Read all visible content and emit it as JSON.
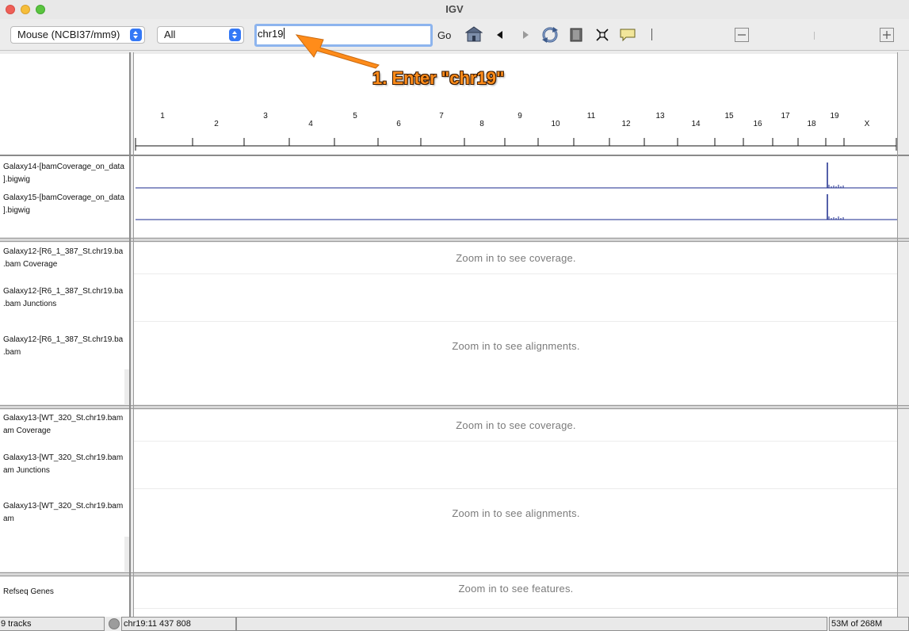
{
  "window": {
    "title": "IGV"
  },
  "toolbar": {
    "genome": "Mouse (NCBI37/mm9)",
    "chromosome": "All",
    "locus_value": "chr19",
    "go_label": "Go"
  },
  "ruler": {
    "chromosomes": [
      "1",
      "2",
      "3",
      "4",
      "5",
      "6",
      "7",
      "8",
      "9",
      "10",
      "11",
      "12",
      "13",
      "14",
      "15",
      "16",
      "17",
      "18",
      "19",
      "X"
    ]
  },
  "tracks": {
    "bigwig": [
      {
        "line1": "Galaxy14-[bamCoverage_on_data",
        "line2": "].bigwig"
      },
      {
        "line1": "Galaxy15-[bamCoverage_on_data",
        "line2": "].bigwig"
      }
    ],
    "group1": {
      "coverage": {
        "line1": "Galaxy12-[R6_1_387_St.chr19.ba",
        "line2": ".bam Coverage"
      },
      "junctions": {
        "line1": "Galaxy12-[R6_1_387_St.chr19.ba",
        "line2": ".bam Junctions"
      },
      "alignments": {
        "line1": "Galaxy12-[R6_1_387_St.chr19.ba",
        "line2": ".bam"
      },
      "coverage_msg": "Zoom in to see coverage.",
      "alignments_msg": "Zoom in to see alignments."
    },
    "group2": {
      "coverage": {
        "line1": "Galaxy13-[WT_320_St.chr19.bam",
        "line2": "am Coverage"
      },
      "junctions": {
        "line1": "Galaxy13-[WT_320_St.chr19.bam",
        "line2": "am Junctions"
      },
      "alignments": {
        "line1": "Galaxy13-[WT_320_St.chr19.bam",
        "line2": "am"
      },
      "coverage_msg": "Zoom in to see coverage.",
      "alignments_msg": "Zoom in to see alignments."
    },
    "refseq": {
      "label": "Refseq Genes",
      "msg": "Zoom in to see features."
    }
  },
  "status": {
    "tracks": "9 tracks",
    "position": "chr19:11 437 808",
    "memory": "53M of 268M"
  },
  "annotation": {
    "text": "1. Enter \"chr19\""
  },
  "colors": {
    "signal": "#1a2a8c",
    "annotation": "#ff8c1a",
    "focus": "#8db4ee"
  }
}
